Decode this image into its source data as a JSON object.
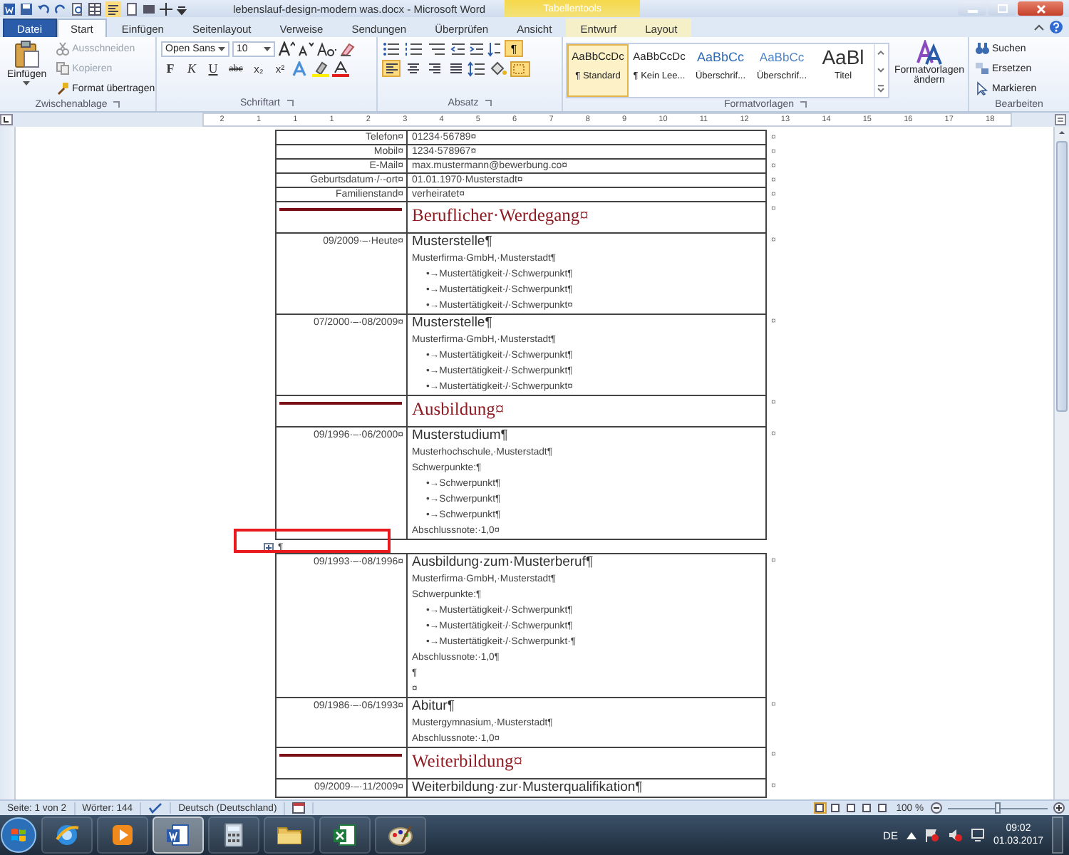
{
  "window": {
    "title": "lebenslauf-design-modern was.docx - Microsoft Word",
    "context_tab": "Tabellentools"
  },
  "tabs": [
    {
      "label": "Datei",
      "kind": "file",
      "selected": false
    },
    {
      "label": "Start",
      "kind": "normal",
      "selected": true
    },
    {
      "label": "Einfügen",
      "kind": "normal",
      "selected": false
    },
    {
      "label": "Seitenlayout",
      "kind": "normal",
      "selected": false
    },
    {
      "label": "Verweise",
      "kind": "normal",
      "selected": false
    },
    {
      "label": "Sendungen",
      "kind": "normal",
      "selected": false
    },
    {
      "label": "Überprüfen",
      "kind": "normal",
      "selected": false
    },
    {
      "label": "Ansicht",
      "kind": "normal",
      "selected": false
    },
    {
      "label": "Entwurf",
      "kind": "context",
      "selected": false
    },
    {
      "label": "Layout",
      "kind": "context",
      "selected": false
    }
  ],
  "clipboard": {
    "label": "Zwischenablage",
    "paste": "Einfügen",
    "items": [
      {
        "label": "Ausschneiden",
        "kind": "cut",
        "disabled": true
      },
      {
        "label": "Kopieren",
        "kind": "copy",
        "disabled": true
      },
      {
        "label": "Format übertragen",
        "kind": "brush",
        "disabled": false
      }
    ]
  },
  "font": {
    "label": "Schriftart",
    "family": "Open Sans",
    "size": "10",
    "buttons": [
      {
        "label": "F",
        "kind": "bold"
      },
      {
        "label": "K",
        "kind": "italic"
      },
      {
        "label": "U",
        "kind": "underline"
      },
      {
        "label": "abc",
        "kind": "strike"
      },
      {
        "label": "x₂",
        "kind": "plain"
      },
      {
        "label": "x²",
        "kind": "plain"
      }
    ]
  },
  "paragraph": {
    "label": "Absatz",
    "marks_button": {
      "label": "¶",
      "selected": true
    },
    "alignments": [
      {
        "kind": "left",
        "selected": true
      },
      {
        "kind": "center",
        "selected": false
      },
      {
        "kind": "right",
        "selected": false
      },
      {
        "kind": "justify",
        "selected": false
      }
    ]
  },
  "styles": {
    "label": "Formatvorlagen",
    "change": "Formatvorlagen ändern",
    "items": [
      {
        "sample": "AaBbCcDc",
        "name": "¶ Standard",
        "kind": "body",
        "selected": true
      },
      {
        "sample": "AaBbCcDc",
        "name": "¶ Kein Lee...",
        "kind": "body",
        "selected": false
      },
      {
        "sample": "AaBbCc",
        "name": "Überschrif...",
        "kind": "heading",
        "selected": false
      },
      {
        "sample": "AaBbCc",
        "name": "Überschrif...",
        "kind": "subheading",
        "selected": false
      },
      {
        "sample": "AaBl",
        "name": "Titel",
        "kind": "title",
        "selected": false
      }
    ]
  },
  "editing": {
    "label": "Bearbeiten",
    "items": [
      {
        "label": "Suchen",
        "kind": "find"
      },
      {
        "label": "Ersetzen",
        "kind": "replace"
      },
      {
        "label": "Markieren",
        "kind": "select"
      }
    ]
  },
  "ruler": {
    "numbers": [
      "2",
      "1",
      "1",
      "1",
      "2",
      "3",
      "4",
      "5",
      "6",
      "7",
      "8",
      "9",
      "10",
      "11",
      "12",
      "13",
      "14",
      "15",
      "16",
      "17",
      "18"
    ]
  },
  "document": {
    "rows": [
      {
        "kind": "personal",
        "label": "Telefon¤",
        "value": "01234·56789¤",
        "end": "¤"
      },
      {
        "kind": "personal",
        "label": "Mobil¤",
        "value": "1234·578967¤",
        "end": "¤"
      },
      {
        "kind": "personal",
        "label": "E-Mail¤",
        "value": "max.mustermann@bewerbung.co¤",
        "end": "¤"
      },
      {
        "kind": "personal",
        "label": "Geburtsdatum·/·-ort¤",
        "value": "01.01.1970·Musterstadt¤",
        "end": "¤"
      },
      {
        "kind": "personal",
        "label": "Familienstand¤",
        "value": "verheiratet¤",
        "end": "¤"
      },
      {
        "kind": "section",
        "title": "Beruflicher·Werdegang¤",
        "end": "¤"
      },
      {
        "kind": "entry",
        "date": "09/2009·–·Heute¤",
        "title": "Musterstelle¶",
        "end": "¤",
        "lines": [
          {
            "kind": "text",
            "text": "Musterfirma·GmbH,·Musterstadt¶"
          },
          {
            "kind": "bullet",
            "text": "•→Mustertätigkeit·/·Schwerpunkt¶"
          },
          {
            "kind": "bullet",
            "text": "•→Mustertätigkeit·/·Schwerpunkt¶"
          },
          {
            "kind": "bullet",
            "text": "•→Mustertätigkeit·/·Schwerpunkt¤"
          }
        ]
      },
      {
        "kind": "entry",
        "date": "07/2000·–·08/2009¤",
        "title": "Musterstelle¶",
        "end": "¤",
        "lines": [
          {
            "kind": "text",
            "text": "Musterfirma·GmbH,·Musterstadt¶"
          },
          {
            "kind": "bullet",
            "text": "•→Mustertätigkeit·/·Schwerpunkt¶"
          },
          {
            "kind": "bullet",
            "text": "•→Mustertätigkeit·/·Schwerpunkt¶"
          },
          {
            "kind": "bullet",
            "text": "•→Mustertätigkeit·/·Schwerpunkt¤"
          }
        ]
      },
      {
        "kind": "section",
        "title": "Ausbildung¤",
        "end": "¤"
      },
      {
        "kind": "entry",
        "date": "09/1996·–·06/2000¤",
        "title": "Musterstudium¶",
        "end": "¤",
        "lines": [
          {
            "kind": "text",
            "text": "Musterhochschule,·Musterstadt¶"
          },
          {
            "kind": "text",
            "text": "Schwerpunkte:¶"
          },
          {
            "kind": "bullet",
            "text": "•→Schwerpunkt¶"
          },
          {
            "kind": "bullet",
            "text": "•→Schwerpunkt¶"
          },
          {
            "kind": "bullet",
            "text": "•→Schwerpunkt¶"
          },
          {
            "kind": "text",
            "text": "Abschlussnote:·1,0¤"
          }
        ]
      },
      {
        "kind": "paragraph",
        "text": "¶",
        "highlighted": true
      },
      {
        "kind": "entry",
        "date": "09/1993·–·08/1996¤",
        "title": "Ausbildung·zum·Musterberuf¶",
        "end": "¤",
        "lines": [
          {
            "kind": "text",
            "text": "Musterfirma·GmbH,·Musterstadt¶"
          },
          {
            "kind": "text",
            "text": "Schwerpunkte:¶"
          },
          {
            "kind": "bullet",
            "text": "•→Mustertätigkeit·/·Schwerpunkt¶"
          },
          {
            "kind": "bullet",
            "text": "•→Mustertätigkeit·/·Schwerpunkt¶"
          },
          {
            "kind": "bullet",
            "text": "•→Mustertätigkeit·/·Schwerpunkt·¶"
          },
          {
            "kind": "text",
            "text": "Abschlussnote:·1,0¶"
          },
          {
            "kind": "text",
            "text": "¶"
          },
          {
            "kind": "text",
            "text": "¤"
          }
        ]
      },
      {
        "kind": "entry",
        "date": "09/1986·–·06/1993¤",
        "title": "Abitur¶",
        "end": "¤",
        "lines": [
          {
            "kind": "text",
            "text": "Mustergymnasium,·Musterstadt¶"
          },
          {
            "kind": "text",
            "text": "Abschlussnote:·1,0¤"
          }
        ]
      },
      {
        "kind": "section",
        "title": "Weiterbildung¤",
        "end": "¤"
      },
      {
        "kind": "entry",
        "date": "09/2009·–·11/2009¤",
        "title": "Weiterbildung·zur·Musterqualifikation¶",
        "end": "¤"
      }
    ]
  },
  "status_bar": {
    "page": "Seite: 1 von 2",
    "words": "Wörter: 144",
    "language": "Deutsch (Deutschland)",
    "views": [
      {
        "selected": true
      },
      {
        "selected": false
      },
      {
        "selected": false
      },
      {
        "selected": false
      },
      {
        "selected": false
      }
    ],
    "zoom": "100 %",
    "zoom_slider": {
      "level": 0.5
    }
  },
  "taskbar": {
    "apps": [
      {
        "kind": "browser",
        "selected": false
      },
      {
        "kind": "media",
        "selected": false
      },
      {
        "kind": "word",
        "selected": true
      },
      {
        "kind": "calculator",
        "selected": false
      },
      {
        "kind": "folder",
        "selected": false
      },
      {
        "kind": "spreadsheet",
        "selected": false
      },
      {
        "kind": "paint",
        "selected": false
      }
    ],
    "language": "DE",
    "time": "09:02",
    "date": "01.03.2017"
  }
}
